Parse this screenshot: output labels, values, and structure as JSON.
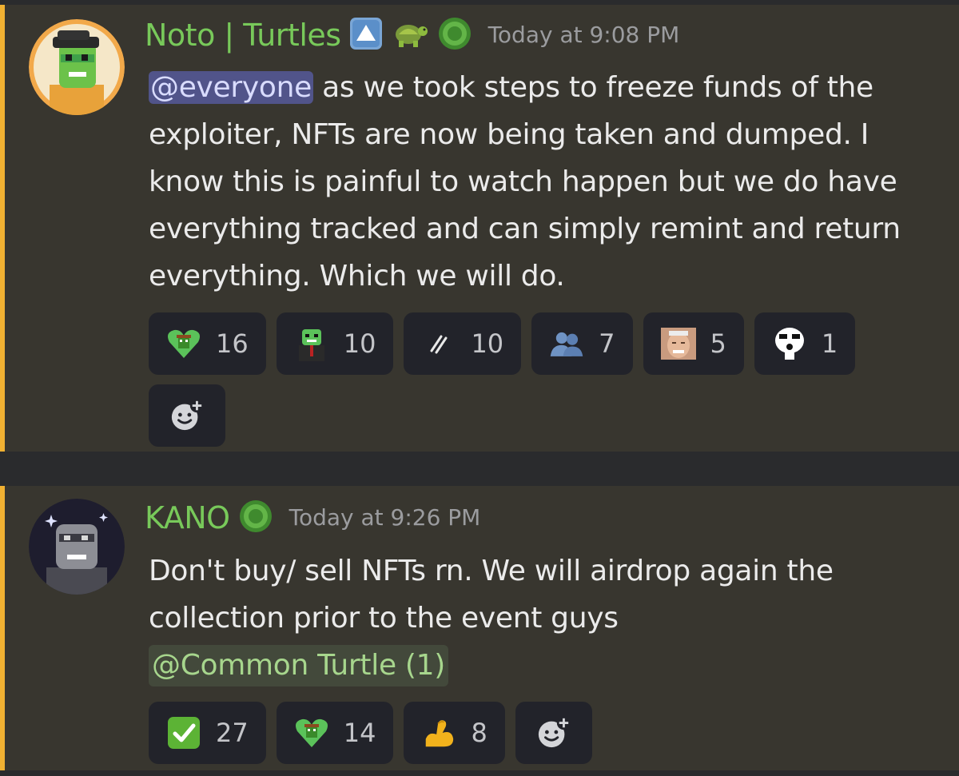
{
  "messages": [
    {
      "author": "Noto | Turtles",
      "badges": [
        "up-arrow-badge",
        "turtle-emoji",
        "green-ring-badge"
      ],
      "timestamp": "Today at 9:08 PM",
      "mention": "@everyone",
      "text": " as we took steps to freeze funds of the exploiter, NFTs are now being taken and dumped. I know this is painful to watch happen but we do have everything tracked and can simply remint and return everything. Which we will do.",
      "reactions": [
        {
          "emoji": "turtle-heart-emoji",
          "count": "16"
        },
        {
          "emoji": "turtle-suit-emoji",
          "count": "10"
        },
        {
          "emoji": "feather-emoji",
          "count": "10"
        },
        {
          "emoji": "people-emoji",
          "count": "7"
        },
        {
          "emoji": "harold-face-emoji",
          "count": "5"
        },
        {
          "emoji": "meme-face-emoji",
          "count": "1"
        }
      ]
    },
    {
      "author": "KANO",
      "badges": [
        "green-ring-badge"
      ],
      "timestamp": "Today at 9:26 PM",
      "text": "Don't buy/ sell NFTs rn. We will airdrop again the collection prior to the event guys",
      "role_mention": "@Common Turtle (1)",
      "reactions": [
        {
          "emoji": "check-mark-emoji",
          "count": "27"
        },
        {
          "emoji": "turtle-heart-emoji",
          "count": "14"
        },
        {
          "emoji": "flexed-bicep-emoji",
          "count": "8"
        }
      ]
    }
  ],
  "colors": {
    "author": "#78c95a",
    "mention_bg": "#51548a",
    "highlight_bar": "#f0b132",
    "message_bg": "#38362f"
  }
}
